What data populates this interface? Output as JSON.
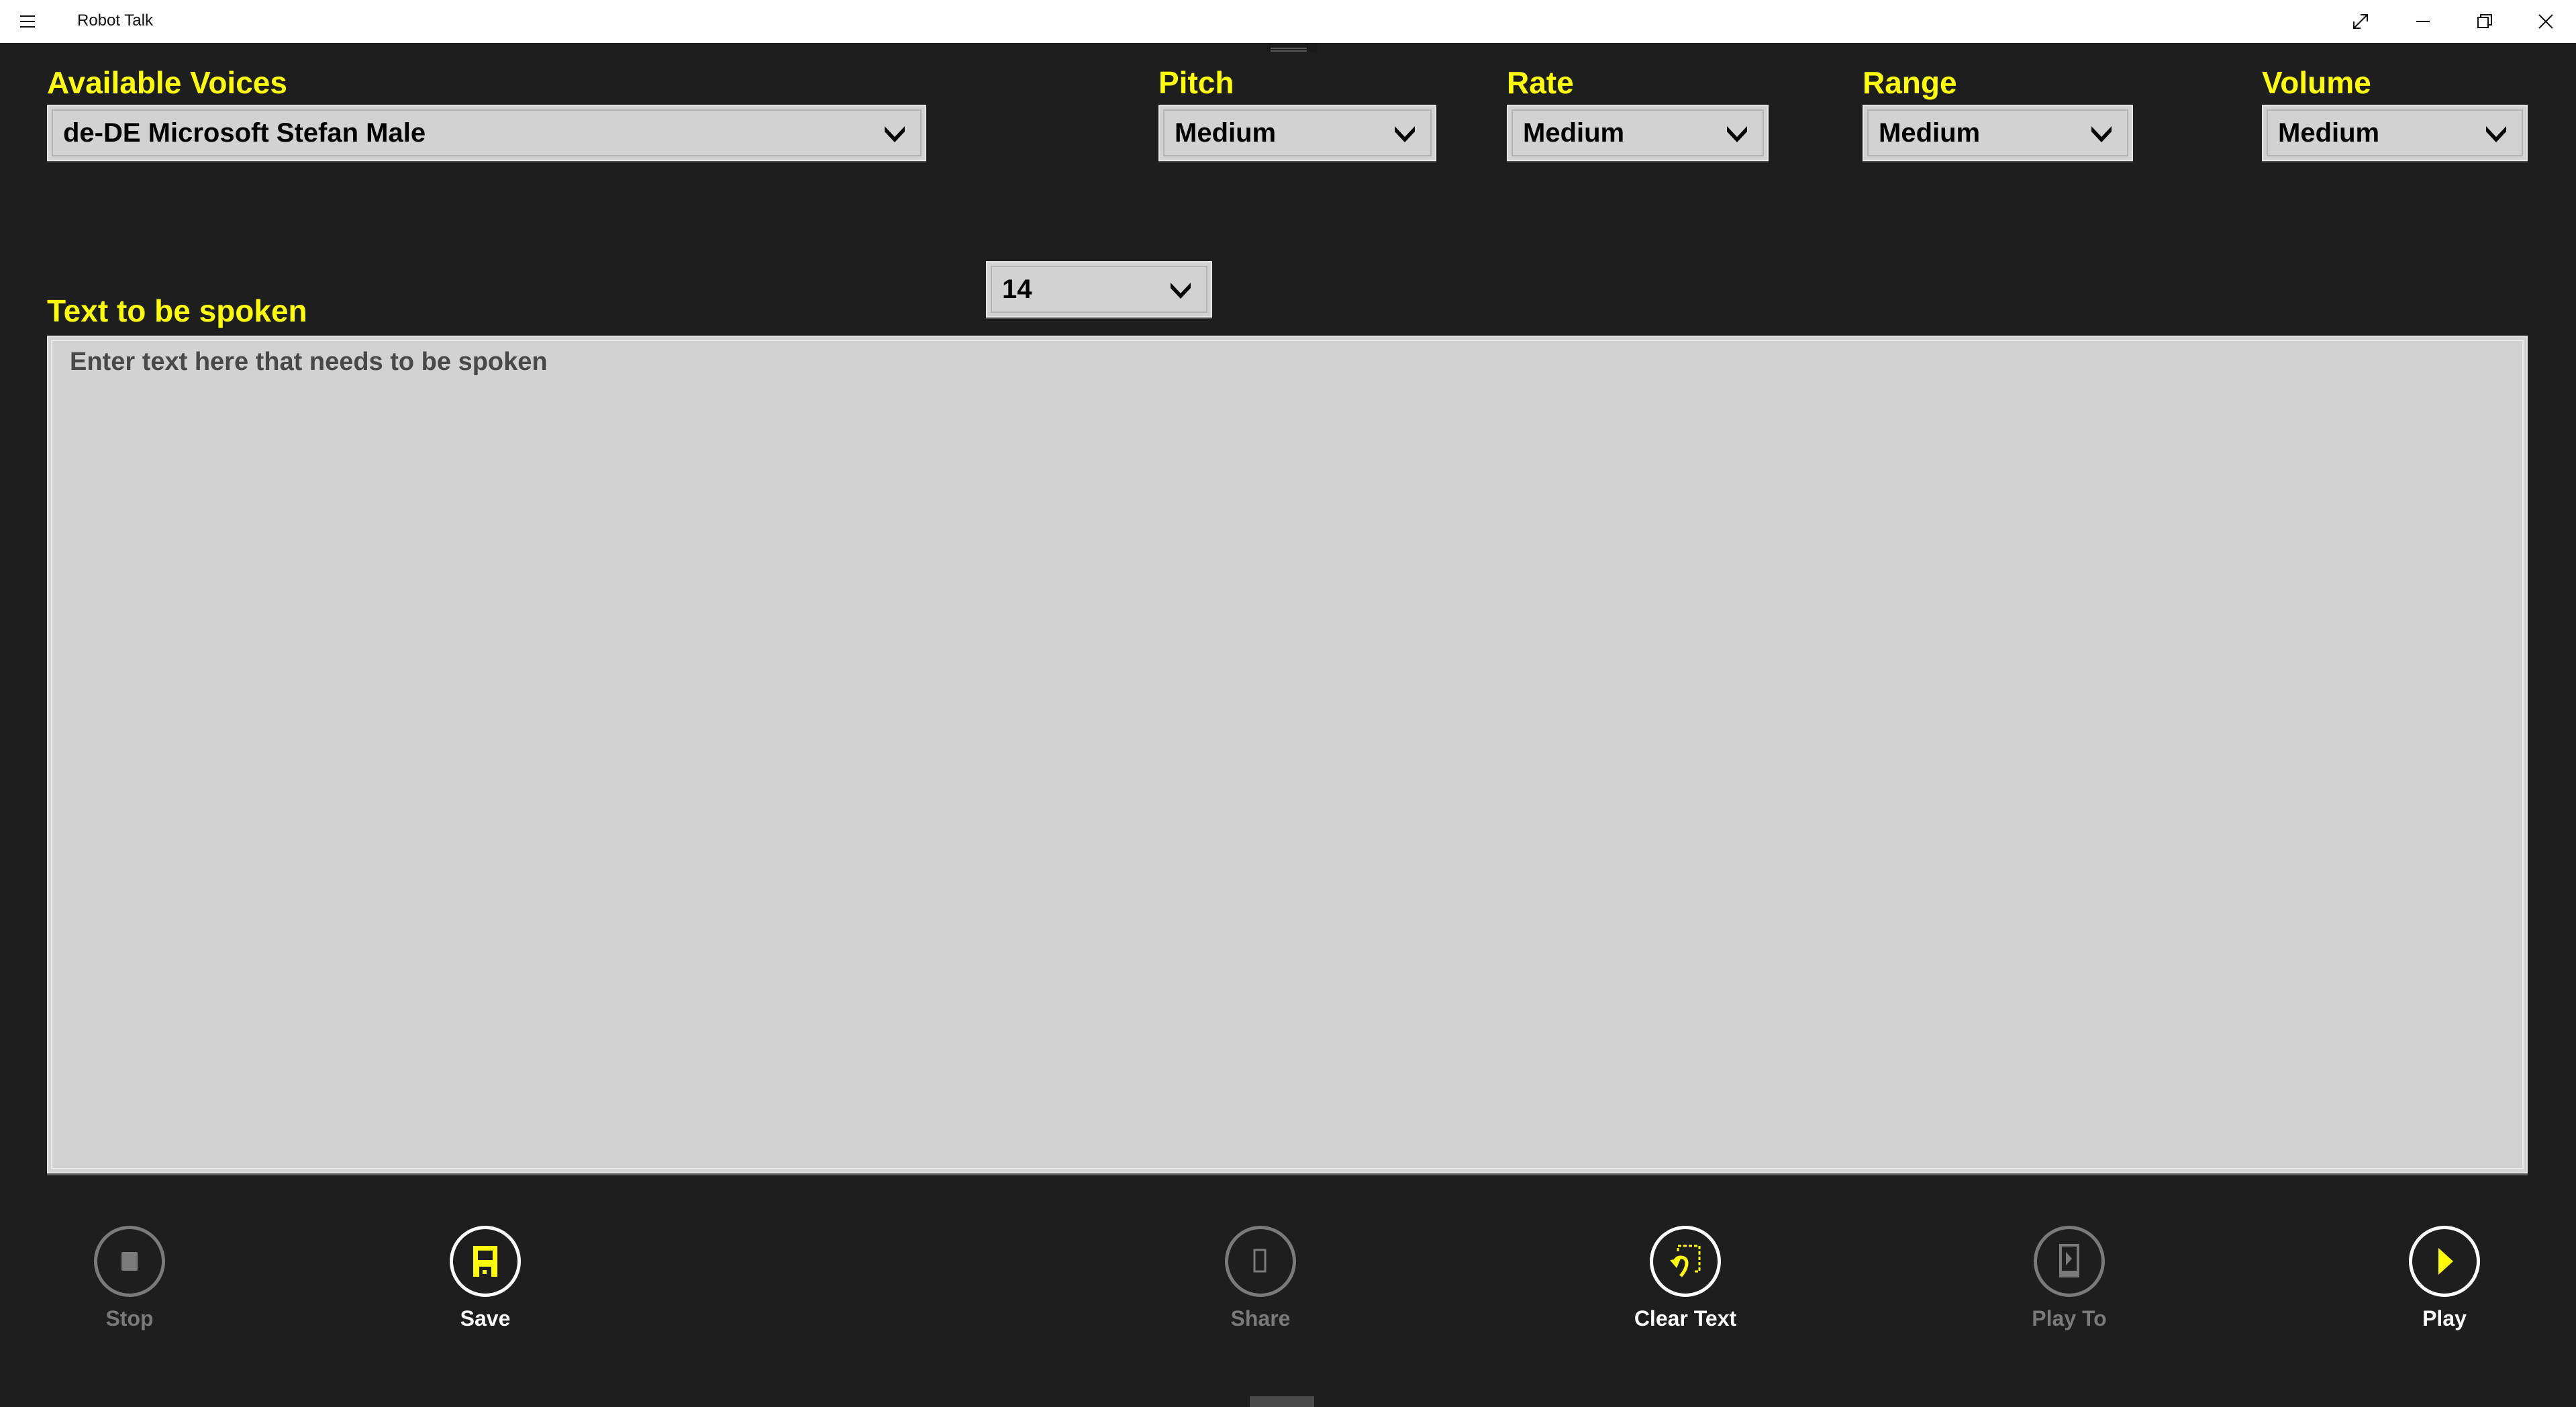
{
  "window": {
    "title": "Robot Talk",
    "controls": [
      {
        "name": "fullscreen",
        "icon": "expand-icon"
      },
      {
        "name": "minimize",
        "icon": "minimize-icon"
      },
      {
        "name": "restore",
        "icon": "restore-icon"
      },
      {
        "name": "close",
        "icon": "close-icon"
      }
    ]
  },
  "colors": {
    "accent": "#FFFF00",
    "background": "#1E1E1E",
    "control_bg": "#D2D2D2",
    "disabled": "#7A7A7A",
    "enabled": "#FFFFFF"
  },
  "settings": {
    "voices": {
      "label": "Available Voices",
      "selected": "de-DE Microsoft Stefan Male"
    },
    "pitch": {
      "label": "Pitch",
      "selected": "Medium"
    },
    "rate": {
      "label": "Rate",
      "selected": "Medium"
    },
    "range": {
      "label": "Range",
      "selected": "Medium"
    },
    "volume": {
      "label": "Volume",
      "selected": "Medium"
    },
    "font_size": {
      "selected": "14"
    }
  },
  "editor": {
    "label": "Text to be spoken",
    "value": "",
    "placeholder": "Enter text here that needs to be spoken"
  },
  "commands": [
    {
      "id": "stop",
      "label": "Stop",
      "icon": "stop-icon",
      "enabled": false
    },
    {
      "id": "save",
      "label": "Save",
      "icon": "save-icon",
      "enabled": true
    },
    {
      "id": "share",
      "label": "Share",
      "icon": "share-icon",
      "enabled": false
    },
    {
      "id": "clear",
      "label": "Clear Text",
      "icon": "clear-text-icon",
      "enabled": true
    },
    {
      "id": "playto",
      "label": "Play To",
      "icon": "play-to-icon",
      "enabled": false
    },
    {
      "id": "play",
      "label": "Play",
      "icon": "play-icon",
      "enabled": true
    }
  ]
}
